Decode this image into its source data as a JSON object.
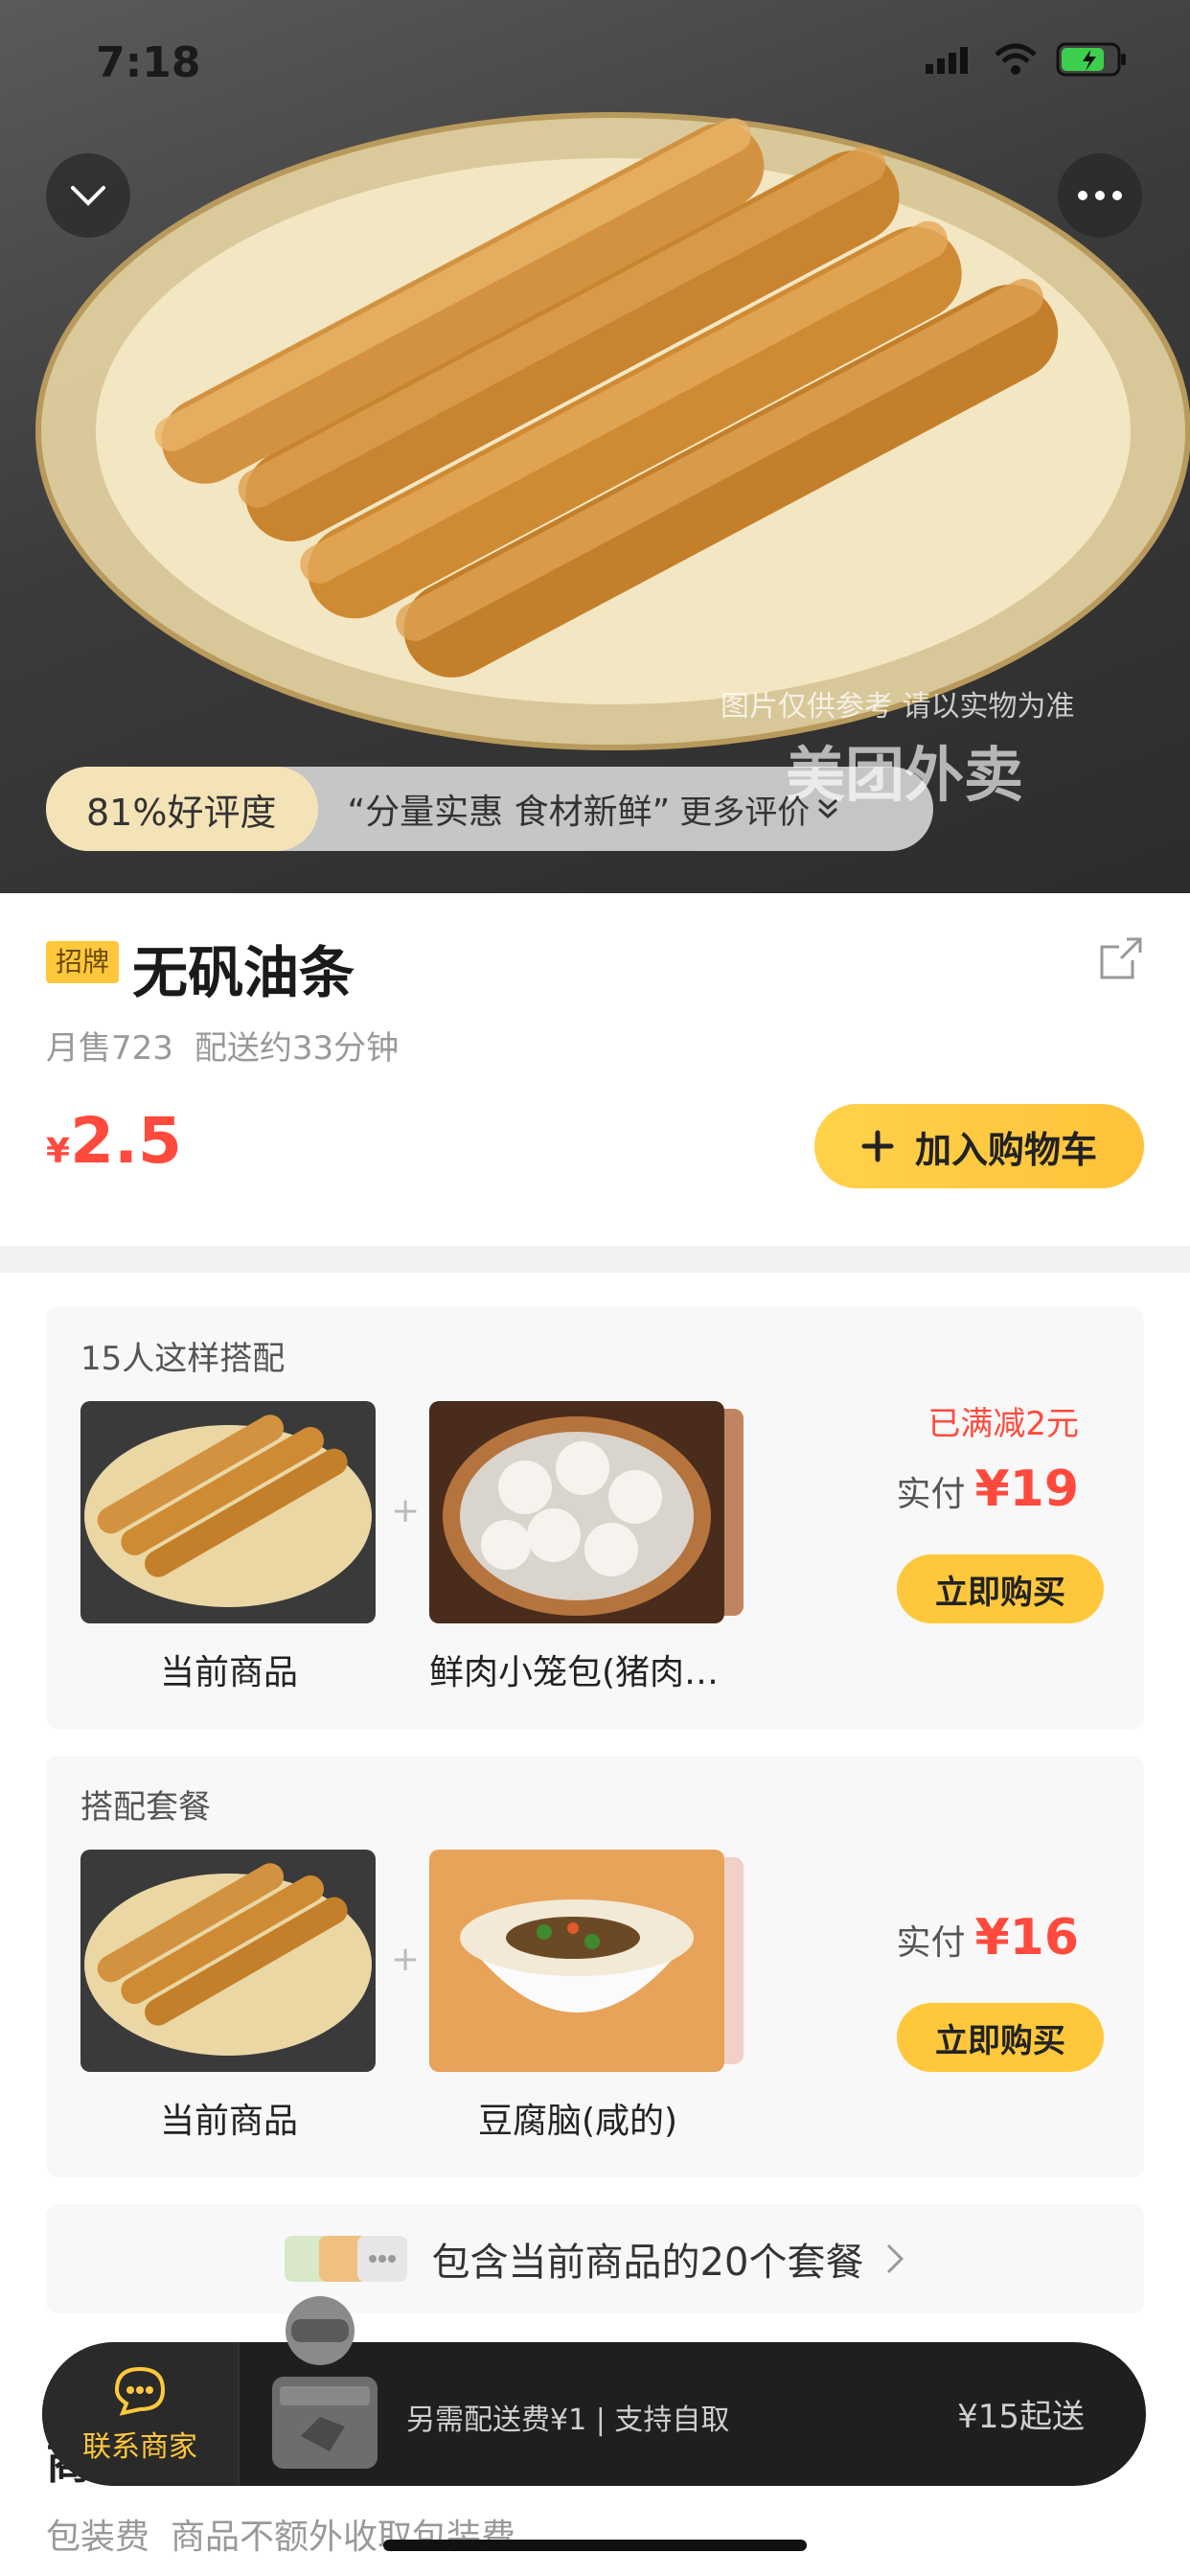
{
  "status_bar": {
    "time": "7:18"
  },
  "hero": {
    "review_score": "81%好评度",
    "review_quote": "“分量实惠 食材新鲜”",
    "review_more": "更多评价",
    "watermark_note": "图片仅供参考 请以实物为准",
    "watermark_brand": "美团外卖"
  },
  "product": {
    "badge": "招牌",
    "name": "无矾油条",
    "monthly_sales": "月售723",
    "delivery_time": "配送约33分钟",
    "currency": "¥",
    "price": "2.5",
    "add_to_cart": "加入购物车"
  },
  "combo1": {
    "title": "15人这样搭配",
    "item1_label": "当前商品",
    "item2_label": "鲜肉小笼包(猪肉…",
    "discount": "已满减2元",
    "pay_label": "实付",
    "pay_amount": "¥19",
    "buy": "立即购买"
  },
  "combo2": {
    "title": "搭配套餐",
    "item1_label": "当前商品",
    "item2_label": "豆腐脑(咸的)",
    "pay_label": "实付",
    "pay_amount": "¥16",
    "buy": "立即购买"
  },
  "more_combos": {
    "text": "包含当前商品的20个套餐"
  },
  "details": {
    "section_title": "商品详情",
    "fee_label": "包装费",
    "fee_text": "商品不额外收取包装费"
  },
  "bottom_bar": {
    "contact": "联系商家",
    "delivery_note": "另需配送费¥1 | 支持自取",
    "min_order": "¥15起送"
  },
  "colors": {
    "accent": "#ffc83c",
    "price": "#ff4a3d",
    "bar": "#1f1f1f"
  }
}
